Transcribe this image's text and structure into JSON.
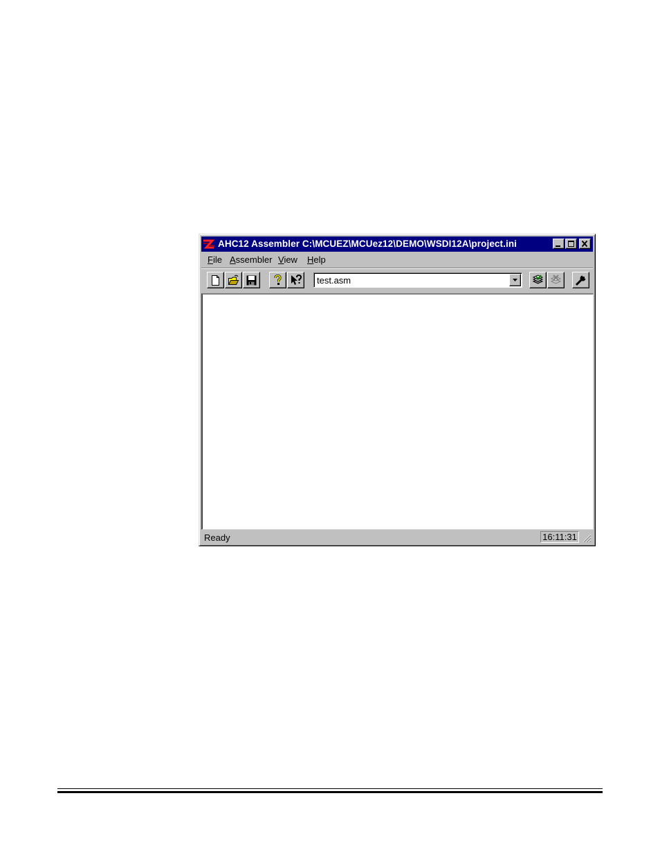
{
  "window": {
    "title": "AHC12 Assembler  C:\\MCUEZ\\MCUez12\\DEMO\\WSDI12A\\project.ini",
    "title_icon": "app-logo-icon",
    "controls": [
      "minimize-icon",
      "maximize-icon",
      "close-icon"
    ]
  },
  "menu": {
    "items": [
      {
        "mnemonic": "F",
        "rest": "ile"
      },
      {
        "mnemonic": "A",
        "rest": "ssembler"
      },
      {
        "mnemonic": "V",
        "rest": "iew"
      },
      {
        "mnemonic": "H",
        "rest": "elp"
      }
    ]
  },
  "toolbar": {
    "buttons": [
      "new-file-icon",
      "open-folder-icon",
      "save-disk-icon",
      "help-icon",
      "context-help-icon",
      "assemble-icon",
      "stop-icon",
      "options-wrench-icon"
    ],
    "file_combo": {
      "value": "test.asm"
    }
  },
  "status": {
    "text": "Ready",
    "clock": "16:11:31"
  },
  "colors": {
    "titlebar": "#000080",
    "face": "#c0c0c0",
    "client": "#ffffff"
  }
}
